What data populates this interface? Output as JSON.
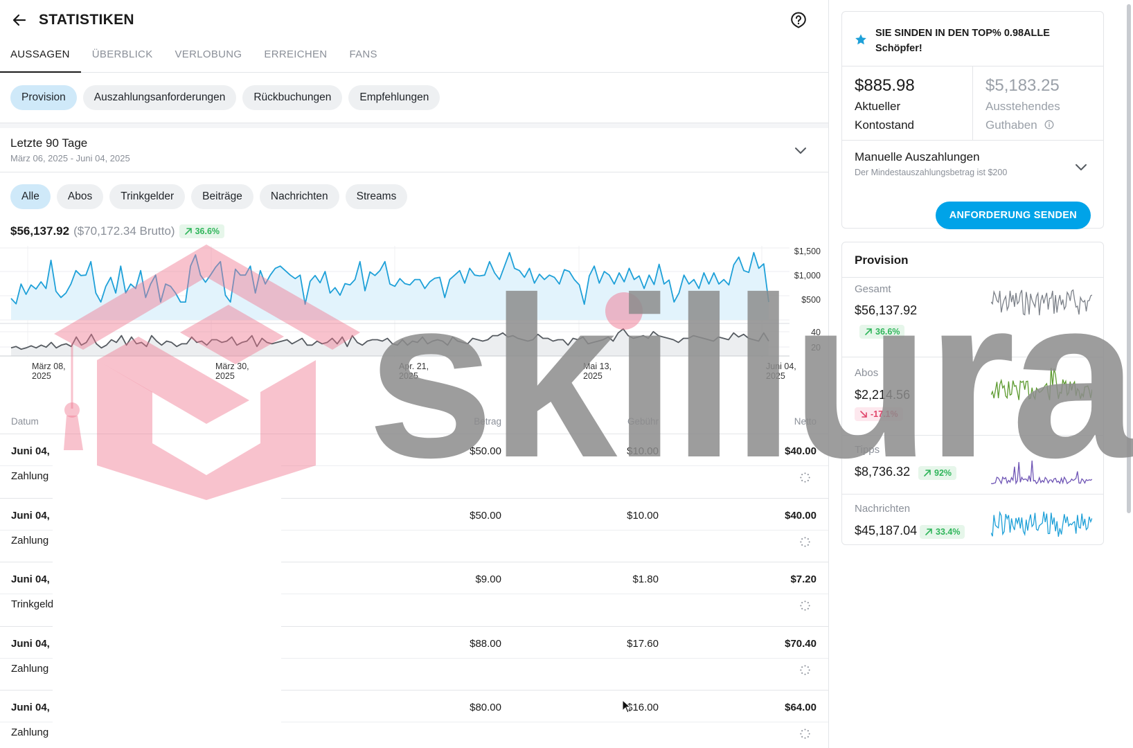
{
  "header": {
    "title": "STATISTIKEN"
  },
  "tabs": [
    {
      "label": "AUSSAGEN",
      "active": true
    },
    {
      "label": "ÜBERBLICK",
      "active": false
    },
    {
      "label": "VERLOBUNG",
      "active": false
    },
    {
      "label": "ERREICHEN",
      "active": false
    },
    {
      "label": "FANS",
      "active": false
    }
  ],
  "subtabs": [
    {
      "label": "Provision",
      "active": true
    },
    {
      "label": "Auszahlungsanforderungen",
      "active": false
    },
    {
      "label": "Rückbuchungen",
      "active": false
    },
    {
      "label": "Empfehlungen",
      "active": false
    }
  ],
  "period": {
    "title": "Letzte 90 Tage",
    "range": "März 06, 2025 - Juni 04, 2025"
  },
  "filters": [
    {
      "label": "Alle",
      "active": true
    },
    {
      "label": "Abos",
      "active": false
    },
    {
      "label": "Trinkgelder",
      "active": false
    },
    {
      "label": "Beiträge",
      "active": false
    },
    {
      "label": "Nachrichten",
      "active": false
    },
    {
      "label": "Streams",
      "active": false
    }
  ],
  "totals": {
    "net": "$56,137.92",
    "gross": "($70,172.34 Brutto)",
    "change": "36.6%"
  },
  "chart_data": {
    "type": "line",
    "x_ticks": [
      {
        "line1": "März 08,",
        "line2": "2025"
      },
      {
        "line1": "März 30,",
        "line2": "2025"
      },
      {
        "line1": "Apr. 21,",
        "line2": "2025"
      },
      {
        "line1": "Mai 13,",
        "line2": "2025"
      },
      {
        "line1": "Juni 04,",
        "line2": "2025"
      }
    ],
    "top_panel": {
      "y_ticks": [
        "$1,500",
        "$1,000",
        "$500"
      ],
      "ylim": [
        0,
        1650
      ],
      "color": "#1ea0d8",
      "fill": "#e2f3fc",
      "values": [
        480,
        360,
        800,
        570,
        780,
        690,
        850,
        700,
        1330,
        640,
        500,
        600,
        800,
        1100,
        990,
        1000,
        1300,
        600,
        400,
        750,
        950,
        600,
        1200,
        600,
        800,
        700,
        1100,
        500,
        800,
        1000,
        400,
        800,
        750,
        600,
        400,
        400,
        1200,
        1450,
        1000,
        840,
        1000,
        1170,
        1300,
        550,
        400,
        1130,
        1000,
        1000,
        1200,
        600,
        1100,
        800,
        1000,
        1150,
        1200,
        1100,
        1000,
        920,
        1000,
        350,
        860,
        990,
        830,
        1080,
        600,
        720,
        550,
        810,
        780,
        900,
        1300,
        650,
        1070,
        990,
        1100,
        1300,
        800,
        750,
        920,
        810,
        780,
        900,
        900,
        700,
        850,
        930,
        950,
        500,
        900,
        1000,
        1100,
        820,
        1150,
        1000,
        980,
        1000,
        1300,
        1050,
        900,
        1200,
        1500,
        1150,
        1100,
        950,
        1150,
        820,
        1020,
        900,
        1000,
        950,
        800,
        1120,
        1080,
        900,
        780,
        350,
        980,
        1200,
        820,
        1080,
        1000,
        800,
        1050,
        850,
        1150,
        900,
        980,
        700,
        1000,
        790,
        1240,
        800,
        890,
        400,
        600,
        1000,
        800,
        900,
        700,
        1050,
        800,
        1050,
        800,
        900,
        780,
        1230,
        1400,
        1100,
        1060,
        1500,
        1150,
        1250,
        400
      ]
    },
    "bottom_panel": {
      "y_ticks": [
        "40",
        "20"
      ],
      "ylim": [
        0,
        48
      ],
      "color": "#555a60",
      "fill": "#eceef0",
      "values": [
        12,
        14,
        10,
        12,
        15,
        12,
        16,
        13,
        20,
        12,
        16,
        18,
        14,
        28,
        16,
        20,
        32,
        18,
        12,
        16,
        24,
        20,
        30,
        16,
        28,
        18,
        20,
        14,
        30,
        22,
        16,
        22,
        20,
        14,
        18,
        18,
        28,
        20,
        22,
        16,
        24,
        24,
        20,
        22,
        28,
        16,
        20,
        22,
        30,
        14,
        26,
        20,
        18,
        20,
        22,
        24,
        18,
        22,
        26,
        16,
        16,
        22,
        18,
        20,
        26,
        18,
        28,
        14,
        30,
        20,
        16,
        22,
        24,
        24,
        22,
        26,
        18,
        16,
        24,
        16,
        22,
        20,
        28,
        18,
        22,
        24,
        22,
        16,
        28,
        22,
        20,
        18,
        26,
        24,
        22,
        24,
        30,
        30,
        34,
        28,
        30,
        26,
        24,
        22,
        24,
        32,
        26,
        26,
        22,
        24,
        24,
        16,
        26,
        24,
        28,
        18,
        20,
        22,
        24,
        28,
        22,
        34,
        40,
        30,
        26,
        28,
        30,
        26,
        36,
        30,
        28,
        26,
        24,
        20,
        26,
        26,
        30,
        28,
        26,
        24,
        22,
        28,
        26,
        24,
        34,
        28,
        32,
        26,
        24,
        22,
        34,
        22
      ]
    }
  },
  "table": {
    "headers": {
      "date": "Datum",
      "amount": "Betrag",
      "fee": "Gebühr",
      "net": "Netto"
    },
    "rows": [
      {
        "date": "Juni 04,",
        "type": "Zahlung",
        "amount": "$50.00",
        "fee": "$10.00",
        "net": "$40.00"
      },
      {
        "date": "Juni 04,",
        "type": "Zahlung",
        "amount": "$50.00",
        "fee": "$10.00",
        "net": "$40.00"
      },
      {
        "date": "Juni 04,",
        "type": "Trinkgeld",
        "amount": "$9.00",
        "fee": "$1.80",
        "net": "$7.20"
      },
      {
        "date": "Juni 04,",
        "type": "Zahlung",
        "amount": "$88.00",
        "fee": "$17.60",
        "net": "$70.40"
      },
      {
        "date": "Juni 04,",
        "type": "Zahlung",
        "amount": "$80.00",
        "fee": "$16.00",
        "net": "$64.00"
      }
    ]
  },
  "side": {
    "top_banner": "SIE SINDEN IN DEN TOP% 0.98ALLE Schöpfer!",
    "current_balance": {
      "amount": "$885.98",
      "label_line1": "Aktueller",
      "label_line2": "Kontostand"
    },
    "pending_balance": {
      "amount": "$5,183.25",
      "label_line1": "Ausstehendes",
      "label_line2": "Guthaben"
    },
    "payout": {
      "title": "Manuelle Auszahlungen",
      "subtitle": "Der Mindestauszahlungsbetrag ist $200",
      "button": "ANFORDERUNG SENDEN"
    },
    "provision": {
      "title": "Provision",
      "stats": [
        {
          "label": "Gesamt",
          "value": "$56,137.92",
          "change": "36.6%",
          "direction": "up",
          "color": "#7b8088"
        },
        {
          "label": "Abos",
          "value": "$2,214.56",
          "change": "-17.1%",
          "direction": "down",
          "color": "#5c9a2f"
        },
        {
          "label": "Tipps",
          "value": "$8,736.32",
          "change": "92%",
          "direction": "up",
          "color": "#6f55b5"
        },
        {
          "label": "Nachrichten",
          "value": "$45,187.04",
          "change": "33.4%",
          "direction": "up",
          "color": "#1ea0d8"
        }
      ]
    }
  },
  "colors": {
    "accent": "#00a3e8",
    "chip_active": "#cfe9f9",
    "up": "#2fb55a",
    "down": "#e0446a"
  },
  "watermark": {
    "text": "skillura"
  }
}
